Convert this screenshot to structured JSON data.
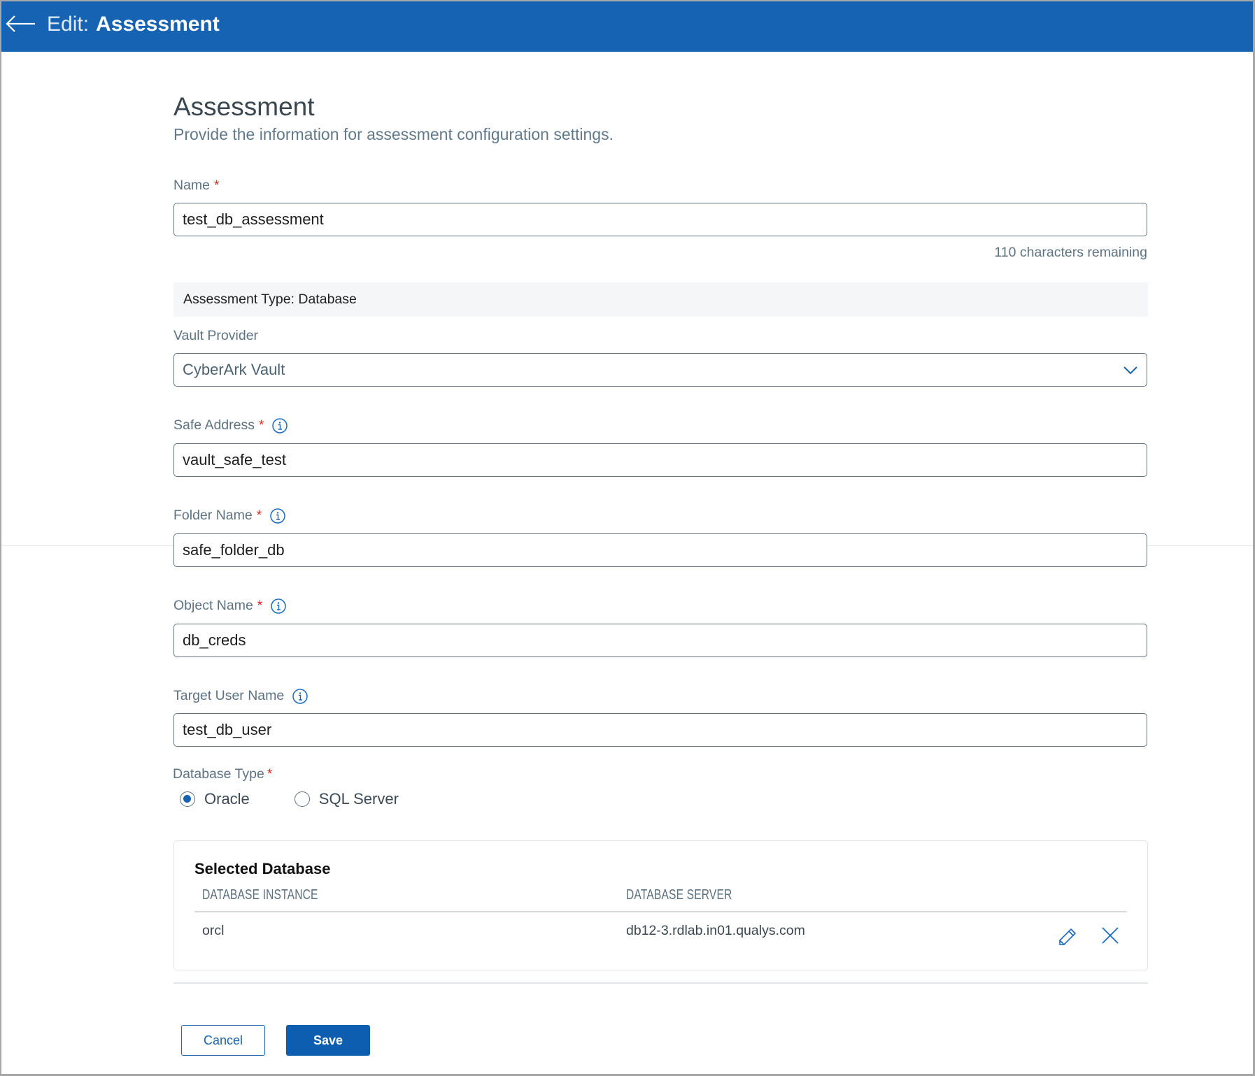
{
  "header": {
    "back_icon": "arrow-left-icon",
    "prefix": "Edit:",
    "title": "Assessment"
  },
  "page": {
    "title": "Assessment",
    "subtitle": "Provide the information for assessment configuration settings."
  },
  "form": {
    "name": {
      "label": "Name",
      "required": "*",
      "value": "test_db_assessment",
      "chars_remaining": "110 characters remaining"
    },
    "assessment_type": "Assessment Type: Database",
    "vault_provider": {
      "label": "Vault Provider",
      "value": "CyberArk Vault",
      "icon": "chevron-down-icon"
    },
    "safe_address": {
      "label": "Safe Address",
      "required": "*",
      "value": "vault_safe_test",
      "icon": "info-icon"
    },
    "folder_name": {
      "label": "Folder Name",
      "required": "*",
      "value": "safe_folder_db",
      "icon": "info-icon"
    },
    "object_name": {
      "label": "Object Name",
      "required": "*",
      "value": "db_creds",
      "icon": "info-icon"
    },
    "target_user_name": {
      "label": "Target User Name",
      "value": "test_db_user",
      "icon": "info-icon"
    },
    "database_type": {
      "label": "Database Type",
      "required": "*",
      "options": [
        {
          "label": "Oracle",
          "selected": true
        },
        {
          "label": "SQL Server",
          "selected": false
        }
      ]
    }
  },
  "selected_database": {
    "title": "Selected Database",
    "columns": [
      "DATABASE INSTANCE",
      "DATABASE SERVER"
    ],
    "rows": [
      {
        "instance": "orcl",
        "server": "db12-3.rdlab.in01.qualys.com",
        "actions": [
          "pencil-icon",
          "close-icon"
        ]
      }
    ]
  },
  "colors": {
    "header_bg": "#1563b2",
    "primary": "#0d5eb1",
    "required": "#d9261c"
  },
  "actions": {
    "cancel": "Cancel",
    "save": "Save"
  }
}
